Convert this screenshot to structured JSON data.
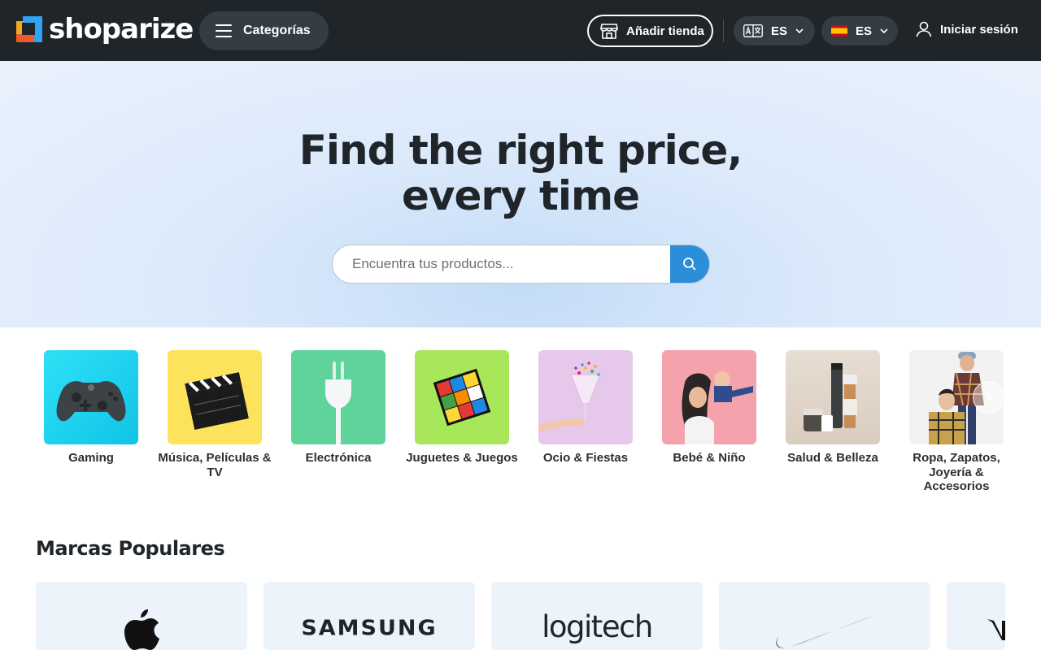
{
  "header": {
    "logo_text": "shoparize",
    "categories_label": "Categorías",
    "add_store_label": "Añadir tienda",
    "language_selector": {
      "value": "ES",
      "icon": "translate-icon"
    },
    "country_selector": {
      "value": "ES",
      "icon": "spain-flag-icon"
    },
    "login_label": "Iniciar sesión"
  },
  "hero": {
    "title_line1": "Find the right price,",
    "title_line2": "every time",
    "search_placeholder": "Encuentra tus productos..."
  },
  "categories": [
    {
      "label": "Gaming"
    },
    {
      "label": "Música, Películas & TV"
    },
    {
      "label": "Electrónica"
    },
    {
      "label": "Juguetes & Juegos"
    },
    {
      "label": "Ocio & Fiestas"
    },
    {
      "label": "Bebé & Niño"
    },
    {
      "label": "Salud & Belleza"
    },
    {
      "label": "Ropa, Zapatos, Joyería & Accesorios"
    }
  ],
  "brands": {
    "title": "Marcas Populares",
    "items": [
      {
        "name": "apple-logo"
      },
      {
        "name": "SAMSUNG"
      },
      {
        "name": "logitech"
      },
      {
        "name": "nike-logo"
      },
      {
        "name": "partial-brand-logo"
      }
    ]
  },
  "colors": {
    "header_bg": "#1f2529",
    "accent": "#2a8fd8",
    "brand_card_bg": "#edf3fb"
  }
}
